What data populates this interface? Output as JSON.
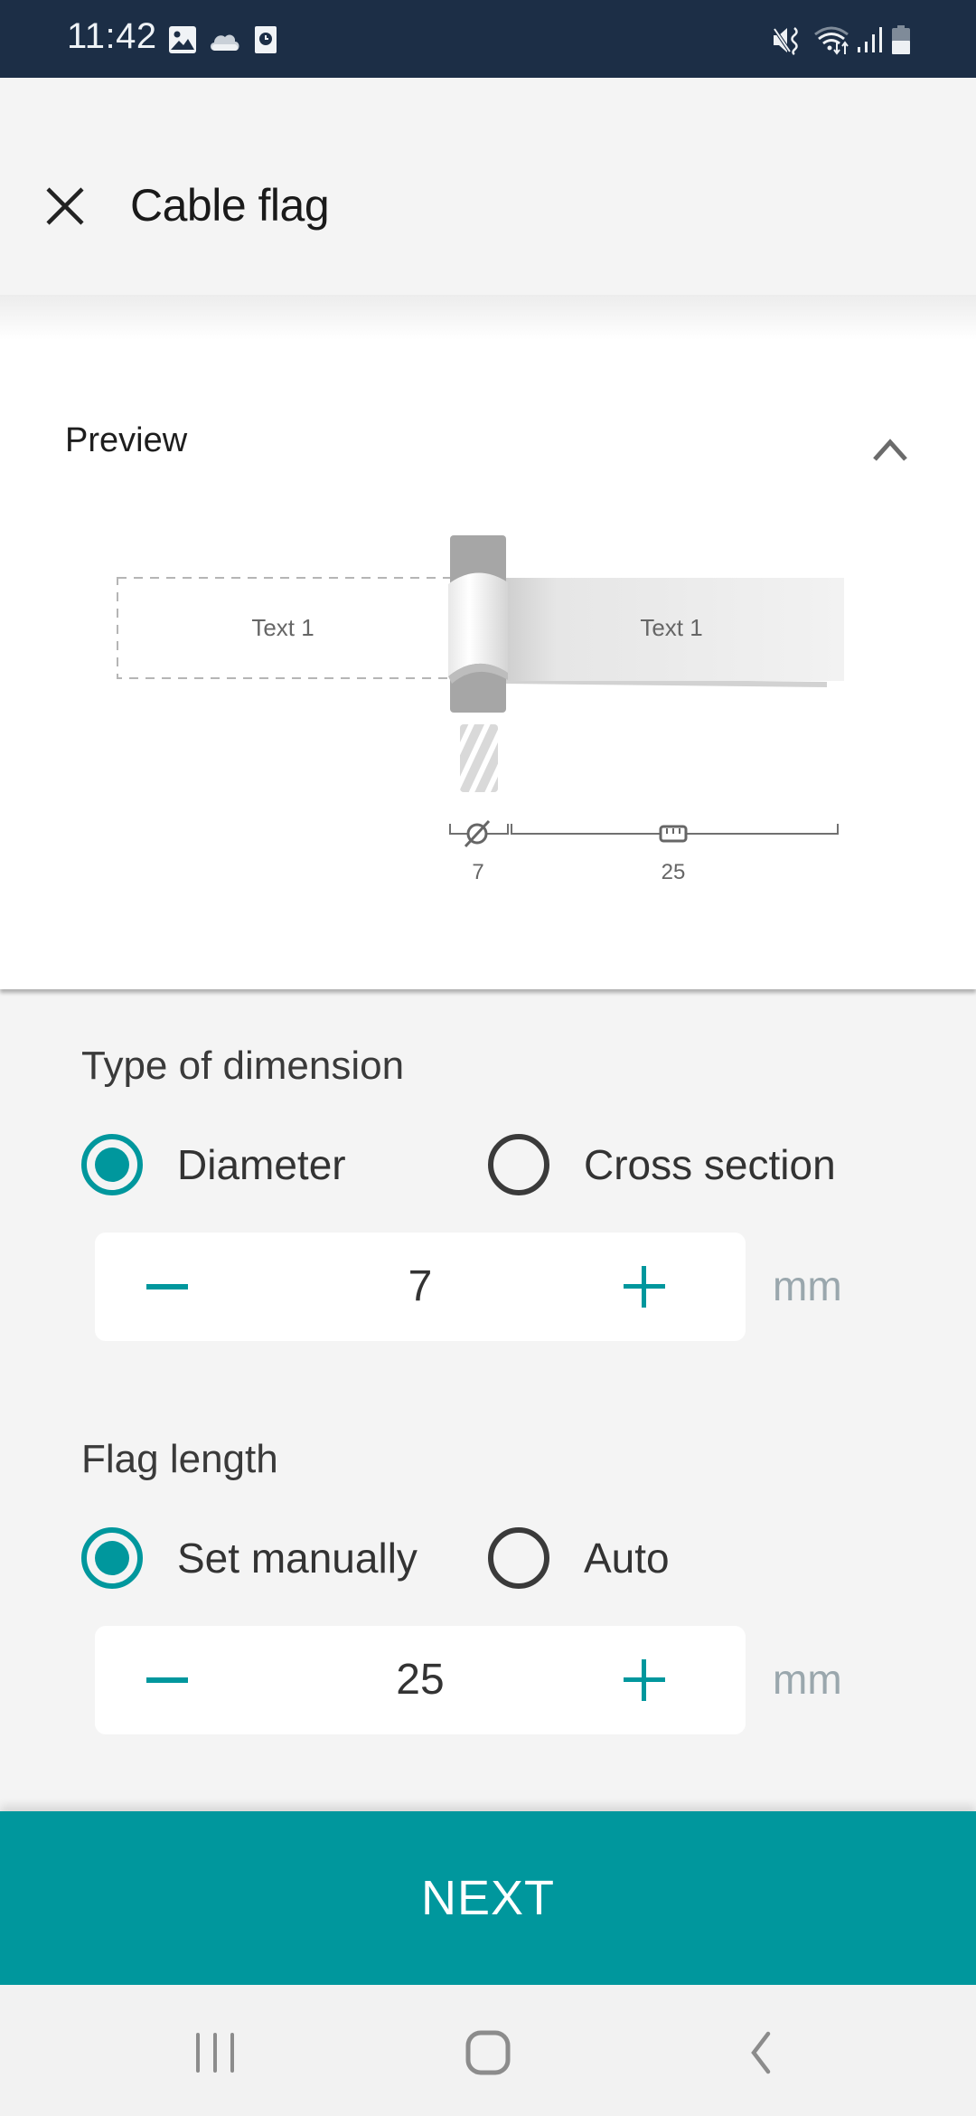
{
  "status_bar": {
    "time": "11:42",
    "left_icons": [
      "gallery-icon",
      "cloud-icon",
      "clock-app-icon"
    ],
    "right_icons": [
      "mute-vibrate-icon",
      "wifi-icon",
      "signal-icon",
      "battery-icon"
    ]
  },
  "app_bar": {
    "close_icon": "close-icon",
    "title": "Cable flag"
  },
  "preview": {
    "title": "Preview",
    "toggle_icon": "chevron-up-icon",
    "flag_left_text": "Text 1",
    "flag_right_text": "Text 1",
    "diameter_label": "7",
    "length_label": "25",
    "diameter_icon": "diameter-icon",
    "length_icon": "ruler-icon"
  },
  "dimension": {
    "label": "Type of dimension",
    "options": [
      {
        "label": "Diameter",
        "selected": true
      },
      {
        "label": "Cross section",
        "selected": false
      }
    ],
    "value": "7",
    "unit": "mm"
  },
  "flag_length": {
    "label": "Flag length",
    "options": [
      {
        "label": "Set manually",
        "selected": true
      },
      {
        "label": "Auto",
        "selected": false
      }
    ],
    "value": "25",
    "unit": "mm"
  },
  "footer": {
    "next_label": "NEXT"
  },
  "colors": {
    "accent": "#00979d",
    "status_bar": "#1c2e46",
    "background": "#f4f4f4"
  },
  "nav_bar": {
    "items": [
      "recent-apps-icon",
      "home-icon",
      "back-icon"
    ]
  }
}
